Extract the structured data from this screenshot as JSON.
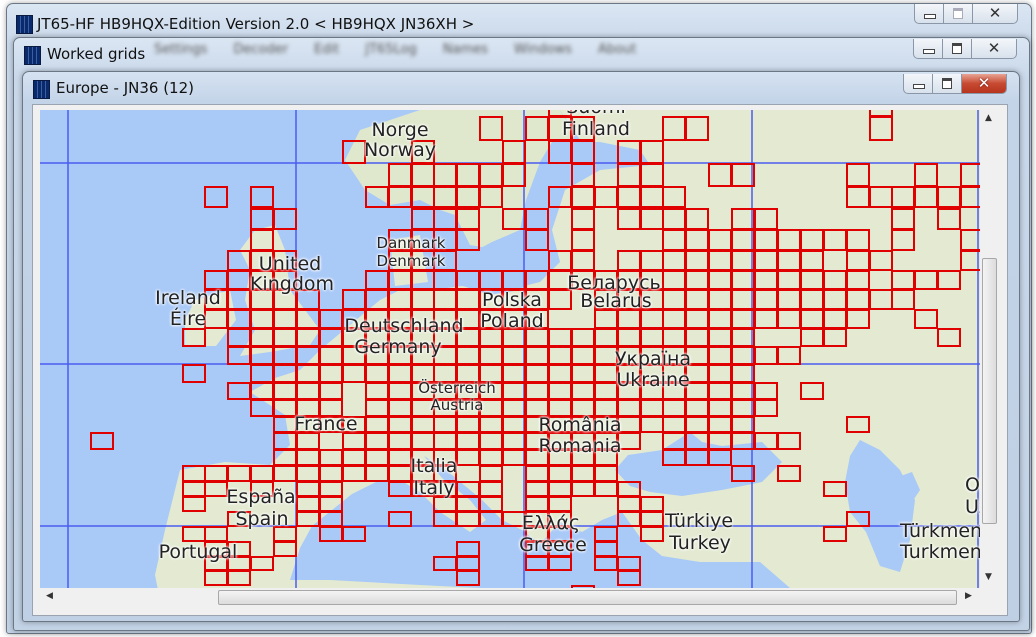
{
  "main_window": {
    "title": "JT65-HF HB9HQX-Edition Version 2.0   < HB9HQX JN36XH >"
  },
  "grids_window": {
    "title": "Worked grids",
    "background_menu": [
      "Settings",
      "Decoder",
      "Edit",
      "JT65Log",
      "Names",
      "Windows",
      "About"
    ]
  },
  "map_window": {
    "title": "Europe - JN36 (12)"
  },
  "colors": {
    "worked": "#e00000",
    "sea": "#a9c9f7",
    "land": "#e3ead1",
    "gridline": "#4a5cf0"
  },
  "map_labels": [
    {
      "id": "suomi",
      "text": "Suomi"
    },
    {
      "id": "finland",
      "text": "Finland"
    },
    {
      "id": "norge",
      "text": "Norge"
    },
    {
      "id": "norway",
      "text": "Norway"
    },
    {
      "id": "danmark",
      "text": "Danmark"
    },
    {
      "id": "denmark",
      "text": "Denmark"
    },
    {
      "id": "united",
      "text": "United"
    },
    {
      "id": "kingdom",
      "text": "Kingdom"
    },
    {
      "id": "ireland",
      "text": "Ireland"
    },
    {
      "id": "eire",
      "text": "Éire"
    },
    {
      "id": "deutschland",
      "text": "Deutschland"
    },
    {
      "id": "germany",
      "text": "Germany"
    },
    {
      "id": "polska",
      "text": "Polska"
    },
    {
      "id": "poland",
      "text": "Poland"
    },
    {
      "id": "belarus_local",
      "text": "Беларусь"
    },
    {
      "id": "belarus",
      "text": "Belarus"
    },
    {
      "id": "ukraine_local",
      "text": "Україна"
    },
    {
      "id": "ukraine",
      "text": "Ukraine"
    },
    {
      "id": "osterreich",
      "text": "Österreich"
    },
    {
      "id": "austria",
      "text": "Austria"
    },
    {
      "id": "france",
      "text": "France"
    },
    {
      "id": "romania_local",
      "text": "România"
    },
    {
      "id": "romania",
      "text": "Romania"
    },
    {
      "id": "italia",
      "text": "Italia"
    },
    {
      "id": "italy",
      "text": "Italy"
    },
    {
      "id": "espana",
      "text": "España"
    },
    {
      "id": "spain",
      "text": "Spain"
    },
    {
      "id": "portugal",
      "text": "Portugal"
    },
    {
      "id": "ellas",
      "text": "Ελλάς"
    },
    {
      "id": "greece",
      "text": "Greece"
    },
    {
      "id": "turkiye",
      "text": "Türkiye"
    },
    {
      "id": "turkey",
      "text": "Turkey"
    },
    {
      "id": "turkmen_local",
      "text": "Türkmenistan"
    },
    {
      "id": "turkmen",
      "text": "Turkmenistan"
    },
    {
      "id": "uzbek_local",
      "text": "Oʻzbekiston"
    },
    {
      "id": "uzbek",
      "text": "Uzbekistan"
    }
  ],
  "worked_grids": {
    "rows": [
      {
        "lat": 62,
        "lons": [
          22,
          50
        ]
      },
      {
        "lat": 61,
        "lons": [
          16,
          20,
          22,
          24,
          32,
          34,
          50
        ]
      },
      {
        "lat": 60,
        "lons": [
          4,
          10,
          18,
          22,
          24,
          28,
          30
        ]
      },
      {
        "lat": 59,
        "lons": [
          8,
          10,
          12,
          14,
          16,
          18,
          24,
          28,
          30,
          36,
          38,
          48,
          54,
          58
        ]
      },
      {
        "lat": 58,
        "lons": [
          -8,
          -4,
          6,
          8,
          10,
          12,
          14,
          16,
          22,
          24,
          26,
          28,
          30,
          32,
          48,
          50,
          52,
          54,
          56,
          58
        ]
      },
      {
        "lat": 57,
        "lons": [
          -4,
          -2,
          10,
          12,
          14,
          18,
          20,
          24,
          28,
          30,
          32,
          34,
          38,
          40,
          52,
          56
        ]
      },
      {
        "lat": 56,
        "lons": [
          -4,
          8,
          10,
          12,
          14,
          20,
          24,
          32,
          34,
          36,
          38,
          40,
          42,
          44,
          46,
          48,
          52,
          58
        ]
      },
      {
        "lat": 55,
        "lons": [
          -6,
          -4,
          -2,
          8,
          10,
          12,
          22,
          24,
          28,
          30,
          32,
          34,
          36,
          38,
          40,
          42,
          44,
          48,
          50,
          58
        ]
      },
      {
        "lat": 54,
        "lons": [
          -8,
          -6,
          -4,
          -2,
          6,
          8,
          10,
          12,
          14,
          16,
          18,
          20,
          22,
          24,
          26,
          28,
          30,
          32,
          34,
          36,
          38,
          40,
          42,
          44,
          46,
          48,
          52,
          54,
          56
        ]
      },
      {
        "lat": 53,
        "lons": [
          -8,
          -6,
          -4,
          -2,
          0,
          4,
          6,
          8,
          10,
          12,
          14,
          16,
          18,
          20,
          22,
          26,
          28,
          30,
          32,
          34,
          36,
          38,
          40,
          42,
          44,
          46,
          48,
          50,
          52
        ]
      },
      {
        "lat": 52,
        "lons": [
          -8,
          -6,
          -4,
          -2,
          0,
          2,
          4,
          6,
          8,
          10,
          12,
          14,
          16,
          18,
          20,
          26,
          28,
          30,
          32,
          34,
          36,
          38,
          40,
          42,
          44,
          46,
          48,
          54
        ]
      },
      {
        "lat": 51,
        "lons": [
          -10,
          -6,
          -4,
          -2,
          0,
          2,
          4,
          6,
          8,
          10,
          12,
          14,
          16,
          18,
          20,
          22,
          24,
          26,
          28,
          30,
          32,
          34,
          36,
          38,
          44,
          46,
          56
        ]
      },
      {
        "lat": 50,
        "lons": [
          -6,
          -4,
          -2,
          0,
          2,
          4,
          6,
          8,
          10,
          12,
          14,
          16,
          18,
          20,
          22,
          24,
          26,
          28,
          30,
          32,
          34,
          36,
          38,
          40,
          42
        ]
      },
      {
        "lat": 49,
        "lons": [
          -10,
          -4,
          -2,
          0,
          2,
          4,
          6,
          8,
          10,
          12,
          14,
          16,
          18,
          20,
          22,
          24,
          26,
          28,
          30,
          32,
          34,
          36,
          38
        ]
      },
      {
        "lat": 48,
        "lons": [
          -6,
          -4,
          -2,
          0,
          2,
          6,
          8,
          10,
          12,
          14,
          16,
          18,
          20,
          22,
          24,
          26,
          28,
          30,
          32,
          34,
          36,
          38,
          40,
          44
        ]
      },
      {
        "lat": 47,
        "lons": [
          -4,
          -2,
          0,
          2,
          6,
          8,
          10,
          12,
          14,
          16,
          18,
          20,
          22,
          24,
          26,
          28,
          30,
          32,
          34,
          36,
          38,
          40
        ]
      },
      {
        "lat": 46,
        "lons": [
          -2,
          0,
          2,
          4,
          6,
          8,
          10,
          12,
          14,
          16,
          18,
          20,
          22,
          24,
          26,
          28,
          30,
          32,
          34,
          36,
          38,
          48
        ]
      },
      {
        "lat": 45,
        "lons": [
          -18,
          -2,
          0,
          4,
          6,
          8,
          10,
          12,
          14,
          16,
          18,
          20,
          22,
          24,
          26,
          28,
          32,
          34,
          36,
          38,
          40,
          42
        ]
      },
      {
        "lat": 44,
        "lons": [
          -2,
          0,
          2,
          4,
          6,
          8,
          10,
          12,
          14,
          16,
          18,
          20,
          22,
          24,
          26,
          32,
          34,
          36
        ]
      },
      {
        "lat": 43,
        "lons": [
          -10,
          -8,
          -6,
          -4,
          -2,
          0,
          2,
          4,
          6,
          8,
          10,
          12,
          16,
          20,
          22,
          24,
          26,
          38,
          42
        ]
      },
      {
        "lat": 42,
        "lons": [
          -10,
          -8,
          -4,
          0,
          2,
          8,
          10,
          12,
          14,
          16,
          20,
          22,
          24,
          26,
          28,
          46
        ]
      },
      {
        "lat": 41,
        "lons": [
          -10,
          0,
          2,
          12,
          14,
          16,
          20,
          22,
          28,
          30
        ]
      },
      {
        "lat": 40,
        "lons": [
          -6,
          0,
          2,
          8,
          12,
          14,
          16,
          18,
          20,
          22,
          28,
          30,
          48
        ]
      },
      {
        "lat": 39,
        "lons": [
          -10,
          -8,
          -2,
          2,
          4,
          20,
          22,
          26,
          30,
          46
        ]
      },
      {
        "lat": 38,
        "lons": [
          -8,
          -6,
          -2,
          14,
          20,
          22,
          26
        ]
      },
      {
        "lat": 37,
        "lons": [
          -8,
          -6,
          -4,
          12,
          14,
          20,
          22,
          26,
          28
        ]
      },
      {
        "lat": 36,
        "lons": [
          -8,
          -6,
          14,
          28
        ]
      },
      {
        "lat": 35,
        "lons": [
          24
        ]
      }
    ]
  }
}
